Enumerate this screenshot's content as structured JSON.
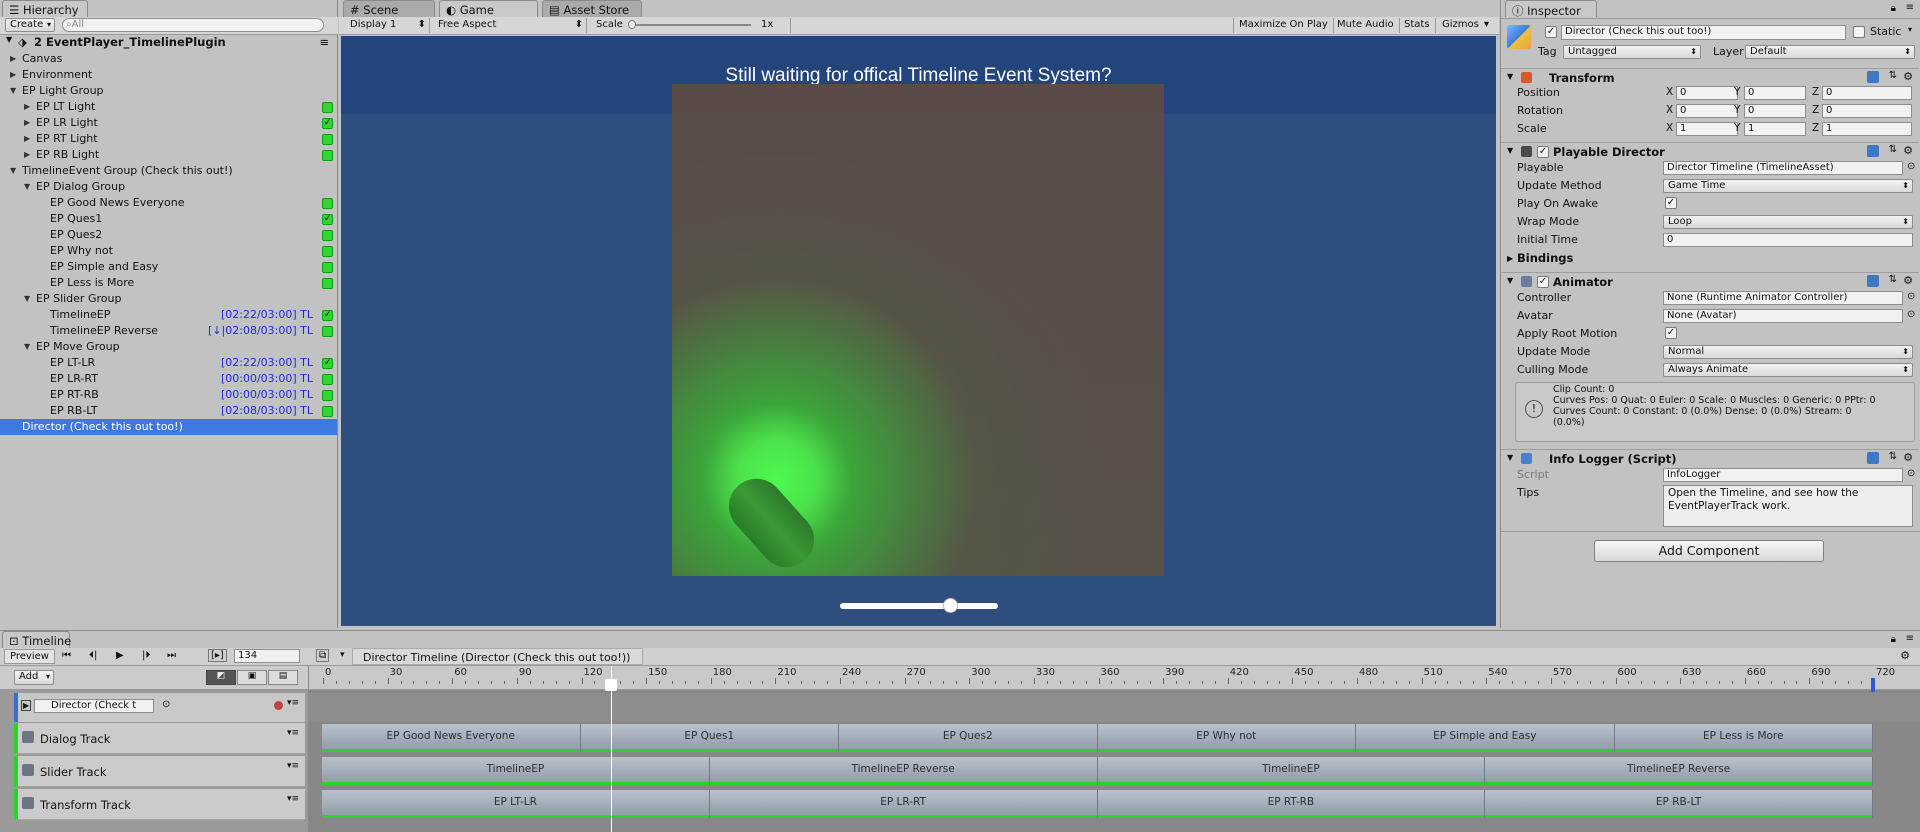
{
  "hierarchy": {
    "tab": "Hierarchy",
    "create": "Create",
    "search_placeholder": "All",
    "scene_name": "2 EventPlayer_TimelinePlugin",
    "rows": [
      {
        "label": "Canvas",
        "indent": 1,
        "fold": "closed"
      },
      {
        "label": "Environment",
        "indent": 1,
        "fold": "closed"
      },
      {
        "label": "EP Light Group",
        "indent": 1,
        "fold": "open"
      },
      {
        "label": "EP LT Light",
        "indent": 2,
        "fold": "closed",
        "box": "on"
      },
      {
        "label": "EP LR Light",
        "indent": 2,
        "fold": "closed",
        "box": "check"
      },
      {
        "label": "EP RT Light",
        "indent": 2,
        "fold": "closed",
        "box": "on"
      },
      {
        "label": "EP RB Light",
        "indent": 2,
        "fold": "closed",
        "box": "on"
      },
      {
        "label": "TimelineEvent Group (Check this out!)",
        "indent": 1,
        "fold": "open"
      },
      {
        "label": "EP Dialog Group",
        "indent": 2,
        "fold": "open"
      },
      {
        "label": "EP Good News Everyone",
        "indent": 3,
        "box": "on"
      },
      {
        "label": "EP Ques1",
        "indent": 3,
        "box": "check"
      },
      {
        "label": "EP Ques2",
        "indent": 3,
        "box": "on"
      },
      {
        "label": "EP Why not",
        "indent": 3,
        "box": "on"
      },
      {
        "label": "EP Simple and Easy",
        "indent": 3,
        "box": "on"
      },
      {
        "label": "EP Less is More",
        "indent": 3,
        "box": "on"
      },
      {
        "label": "EP Slider Group",
        "indent": 2,
        "fold": "open"
      },
      {
        "label": "TimelineEP",
        "indent": 3,
        "tl": "[02:22/03:00] TL",
        "box": "check"
      },
      {
        "label": "TimelineEP Reverse",
        "indent": 3,
        "tl": "[↓|02:08/03:00] TL",
        "box": "on"
      },
      {
        "label": "EP Move Group",
        "indent": 2,
        "fold": "open"
      },
      {
        "label": "EP LT-LR",
        "indent": 3,
        "tl": "[02:22/03:00] TL",
        "box": "check"
      },
      {
        "label": "EP LR-RT",
        "indent": 3,
        "tl": "[00:00/03:00] TL",
        "box": "on"
      },
      {
        "label": "EP RT-RB",
        "indent": 3,
        "tl": "[00:00/03:00] TL",
        "box": "on"
      },
      {
        "label": "EP RB-LT",
        "indent": 3,
        "tl": "[02:08/03:00] TL",
        "box": "on"
      },
      {
        "label": "Director  (Check this out too!)",
        "indent": 1,
        "selected": true
      }
    ]
  },
  "tabs": {
    "scene": "Scene",
    "game": "Game",
    "asset_store": "Asset Store"
  },
  "game": {
    "display": "Display 1",
    "aspect": "Free Aspect",
    "scale_label": "Scale",
    "scale_value": "1x",
    "maximize": "Maximize On Play",
    "mute": "Mute Audio",
    "stats": "Stats",
    "gizmos": "Gizmos",
    "banner": "Still waiting for offical Timeline Event System?",
    "slider_level": 0.7
  },
  "inspector": {
    "tab": "Inspector",
    "object_name": "Director  (Check this out too!)",
    "static_label": "Static",
    "tag_label": "Tag",
    "tag_value": "Untagged",
    "layer_label": "Layer",
    "layer_value": "Default",
    "transform": {
      "title": "Transform",
      "rows": [
        {
          "label": "Position",
          "x": "0",
          "y": "0",
          "z": "0"
        },
        {
          "label": "Rotation",
          "x": "0",
          "y": "0",
          "z": "0"
        },
        {
          "label": "Scale",
          "x": "1",
          "y": "1",
          "z": "1"
        }
      ]
    },
    "director": {
      "title": "Playable Director",
      "playable_label": "Playable",
      "playable_value": "Director Timeline (TimelineAsset)",
      "update_label": "Update Method",
      "update_value": "Game Time",
      "awake_label": "Play On Awake",
      "wrap_label": "Wrap Mode",
      "wrap_value": "Loop",
      "initial_label": "Initial Time",
      "initial_value": "0",
      "bindings": "Bindings"
    },
    "animator": {
      "title": "Animator",
      "controller_label": "Controller",
      "controller_value": "None (Runtime Animator Controller)",
      "avatar_label": "Avatar",
      "avatar_value": "None (Avatar)",
      "root_label": "Apply Root Motion",
      "update_label": "Update Mode",
      "update_value": "Normal",
      "culling_label": "Culling Mode",
      "culling_value": "Always Animate",
      "info1": "Clip Count: 0",
      "info2": "Curves Pos: 0 Quat: 0 Euler: 0 Scale: 0 Muscles: 0 Generic: 0 PPtr: 0",
      "info3": "Curves Count: 0 Constant: 0 (0.0%) Dense: 0 (0.0%) Stream: 0",
      "info4": "(0.0%)"
    },
    "logger": {
      "title": "Info Logger (Script)",
      "script_label": "Script",
      "script_value": "InfoLogger",
      "tips_label": "Tips",
      "tips_line1": "Open the Timeline, and see how the",
      "tips_line2": "EventPlayerTrack work."
    },
    "add_component": "Add Component"
  },
  "timeline": {
    "tab": "Timeline",
    "preview": "Preview",
    "frame": "134",
    "breadcrumb": "Director Timeline (Director  (Check this out too!))",
    "add": "Add",
    "ruler": [
      "0",
      "30",
      "60",
      "90",
      "120",
      "150",
      "180",
      "210",
      "240",
      "270",
      "300",
      "330",
      "360",
      "390",
      "420",
      "450",
      "480",
      "510",
      "540",
      "570",
      "600",
      "630",
      "660",
      "690",
      "720"
    ],
    "director_track": "Director  (Check t",
    "tracks": [
      {
        "name": "Dialog Track",
        "clips": [
          {
            "label": "EP Good News Everyone",
            "start": 0,
            "end": 120
          },
          {
            "label": "EP Ques1",
            "start": 120,
            "end": 240
          },
          {
            "label": "EP Ques2",
            "start": 240,
            "end": 360
          },
          {
            "label": "EP Why not",
            "start": 360,
            "end": 480
          },
          {
            "label": "EP Simple and Easy",
            "start": 480,
            "end": 600
          },
          {
            "label": "EP Less is More",
            "start": 600,
            "end": 720
          }
        ]
      },
      {
        "name": "Slider Track",
        "clips": [
          {
            "label": "TimelineEP",
            "start": 0,
            "end": 180
          },
          {
            "label": "TimelineEP Reverse",
            "start": 180,
            "end": 360
          },
          {
            "label": "TimelineEP",
            "start": 360,
            "end": 540
          },
          {
            "label": "TimelineEP Reverse",
            "start": 540,
            "end": 720
          }
        ]
      },
      {
        "name": "Transform Track",
        "clips": [
          {
            "label": "EP LT-LR",
            "start": 0,
            "end": 180
          },
          {
            "label": "EP LR-RT",
            "start": 180,
            "end": 360
          },
          {
            "label": "EP RT-RB",
            "start": 360,
            "end": 540
          },
          {
            "label": "EP RB-LT",
            "start": 540,
            "end": 720
          }
        ]
      }
    ]
  }
}
